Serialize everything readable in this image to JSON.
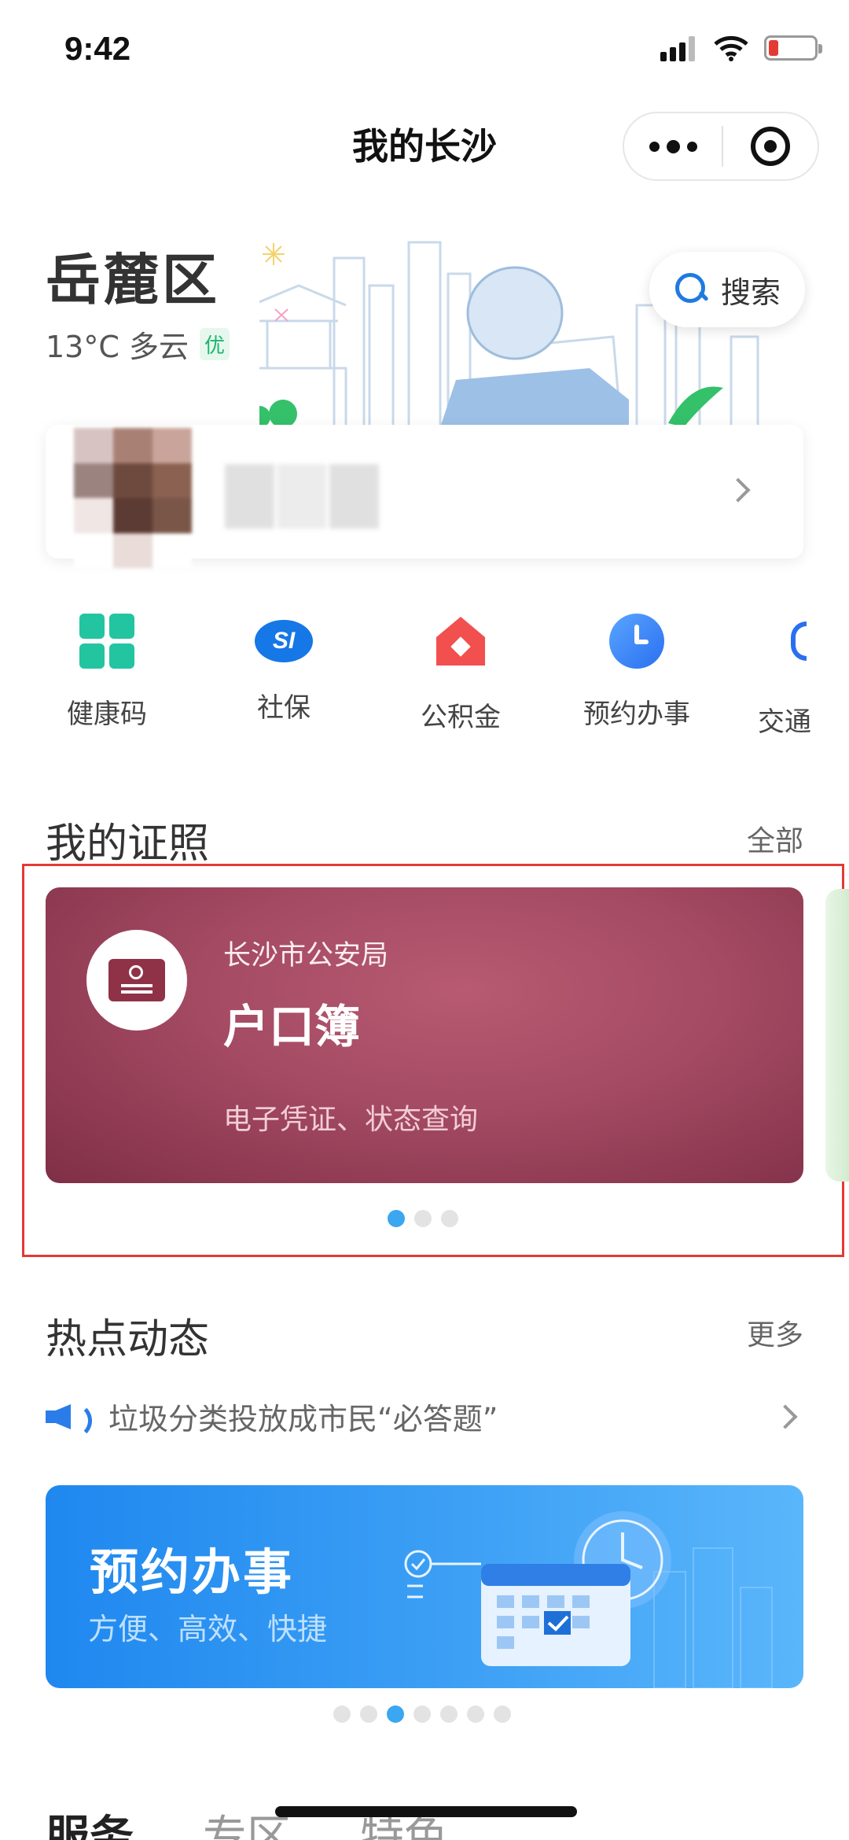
{
  "status_bar": {
    "time": "9:42"
  },
  "nav": {
    "title": "我的长沙"
  },
  "header": {
    "district": "岳麓区",
    "weather": "13°C 多云",
    "air_quality": "优",
    "search_label": "搜索"
  },
  "quick_services": [
    {
      "label": "健康码",
      "icon": "health-code-icon"
    },
    {
      "label": "社保",
      "icon": "social-security-icon"
    },
    {
      "label": "公积金",
      "icon": "housing-fund-icon"
    },
    {
      "label": "预约办事",
      "icon": "clock-icon"
    },
    {
      "label": "交通",
      "icon": "traffic-icon"
    }
  ],
  "certificates": {
    "title": "我的证照",
    "more": "全部",
    "card": {
      "issuer": "长沙市公安局",
      "name": "户口簿",
      "desc": "电子凭证、状态查询"
    },
    "pager": {
      "count": 3,
      "active": 0
    }
  },
  "hot_news": {
    "title": "热点动态",
    "more": "更多",
    "headline": "垃圾分类投放成市民“必答题”",
    "banner": {
      "title": "预约办事",
      "subtitle": "方便、高效、快捷"
    },
    "pager": {
      "count": 7,
      "active": 2
    }
  },
  "tabs": [
    "服务",
    "专区",
    "特色"
  ],
  "colors": {
    "accent": "#1f7ae0",
    "cert_card": "#a44a63",
    "highlight_border": "#e53935"
  }
}
